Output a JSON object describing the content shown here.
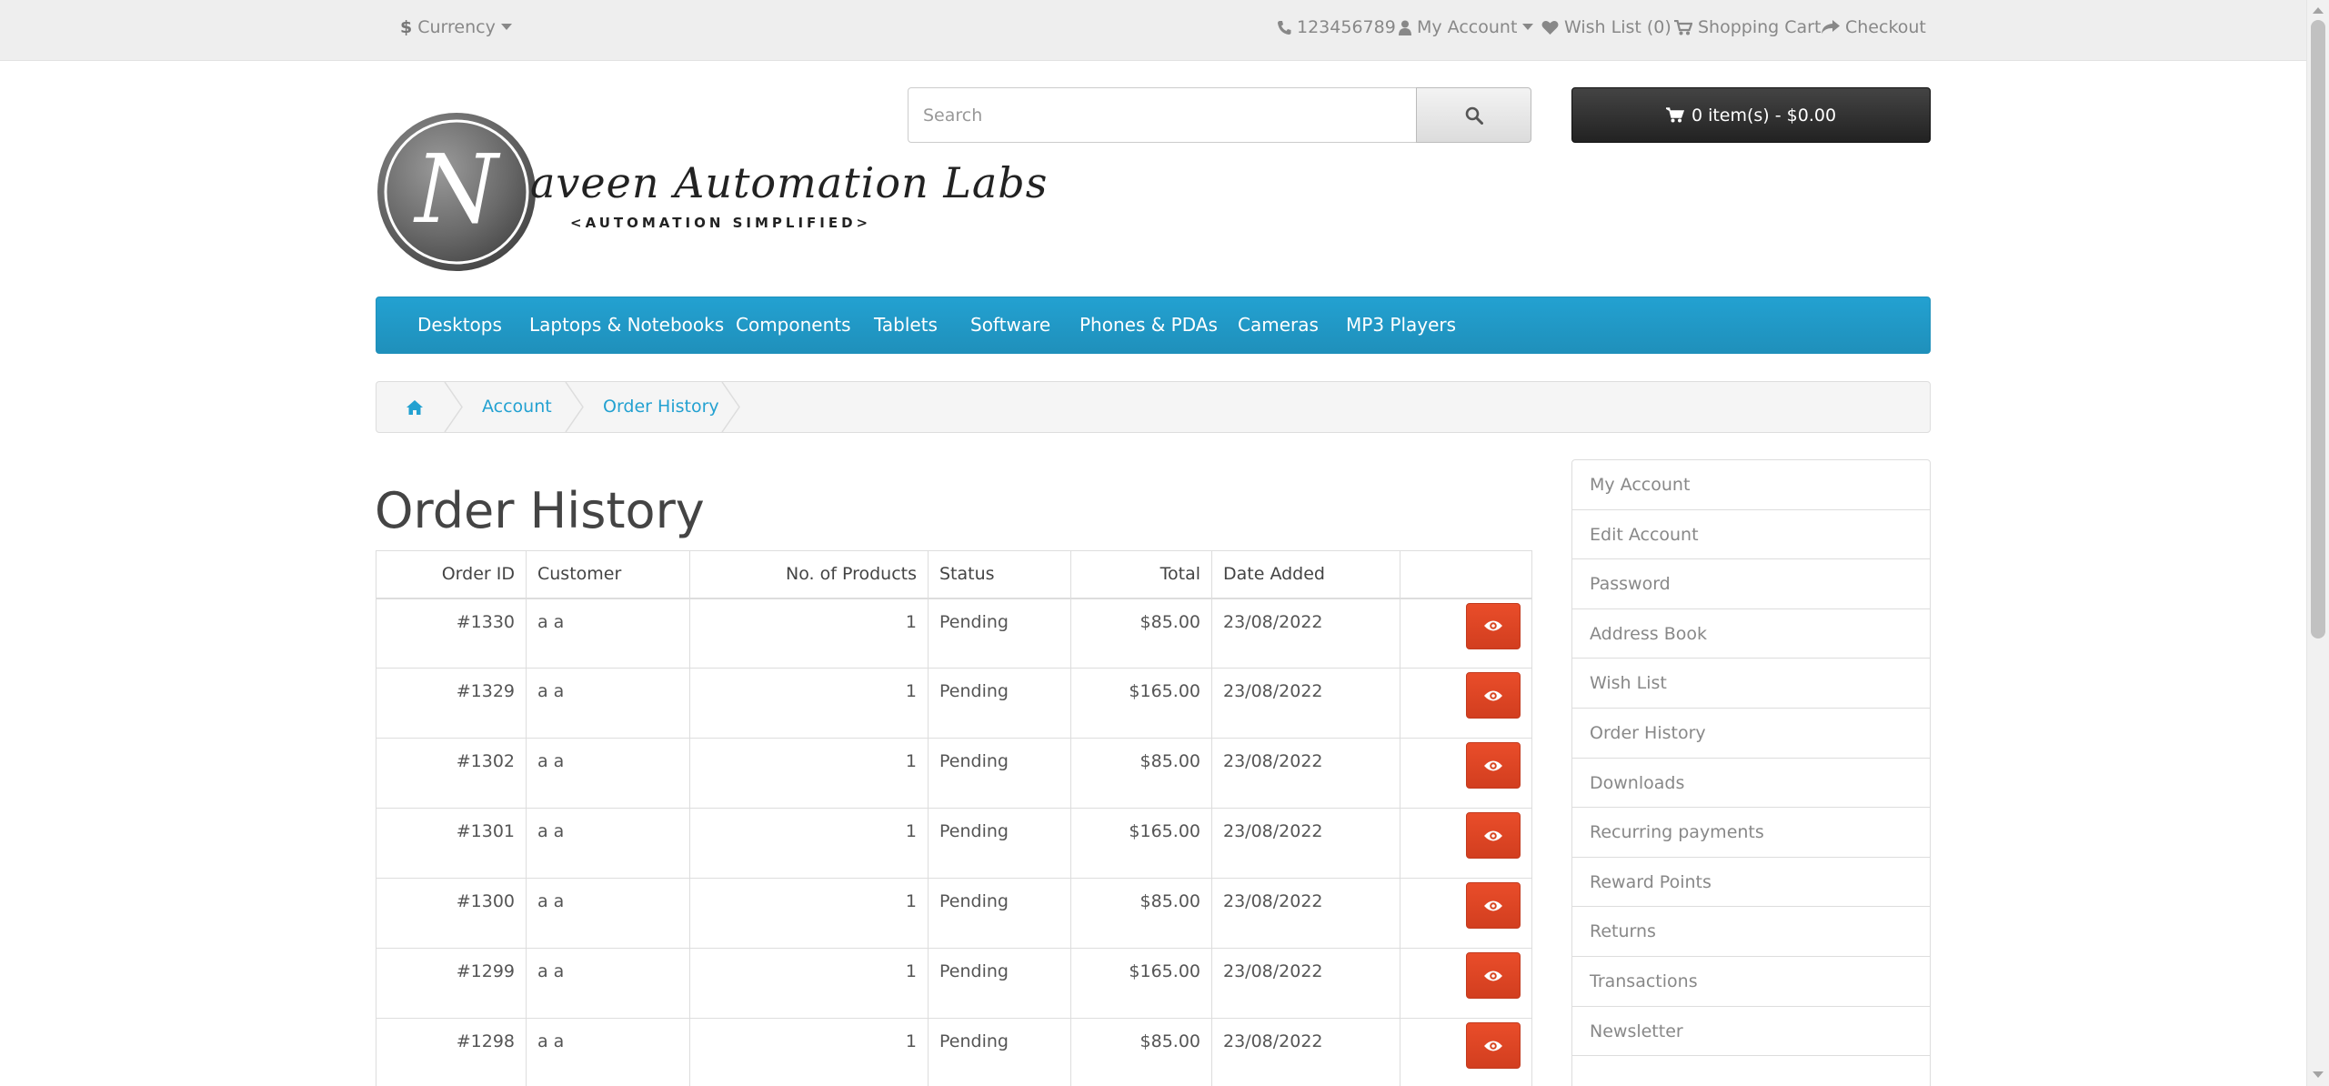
{
  "top_bar": {
    "currency_symbol": "$",
    "currency_label": "Currency",
    "phone": "123456789",
    "my_account": "My Account",
    "wish_list": "Wish List (0)",
    "shopping_cart": "Shopping Cart",
    "checkout": "Checkout"
  },
  "logo": {
    "script": "aveen Automation Labs",
    "letter": "N",
    "tagline": "<AUTOMATION SIMPLIFIED>"
  },
  "search": {
    "placeholder": "Search"
  },
  "cart": {
    "label": "0 item(s) - $0.00"
  },
  "menu": {
    "items": [
      "Desktops",
      "Laptops & Notebooks",
      "Components",
      "Tablets",
      "Software",
      "Phones & PDAs",
      "Cameras",
      "MP3 Players"
    ]
  },
  "breadcrumb": {
    "account": "Account",
    "order_history": "Order History"
  },
  "page_title": "Order History",
  "table": {
    "headers": [
      "Order ID",
      "Customer",
      "No. of Products",
      "Status",
      "Total",
      "Date Added"
    ],
    "rows": [
      {
        "id": "#1330",
        "customer": "a a",
        "products": "1",
        "status": "Pending",
        "total": "$85.00",
        "date": "23/08/2022"
      },
      {
        "id": "#1329",
        "customer": "a a",
        "products": "1",
        "status": "Pending",
        "total": "$165.00",
        "date": "23/08/2022"
      },
      {
        "id": "#1302",
        "customer": "a a",
        "products": "1",
        "status": "Pending",
        "total": "$85.00",
        "date": "23/08/2022"
      },
      {
        "id": "#1301",
        "customer": "a a",
        "products": "1",
        "status": "Pending",
        "total": "$165.00",
        "date": "23/08/2022"
      },
      {
        "id": "#1300",
        "customer": "a a",
        "products": "1",
        "status": "Pending",
        "total": "$85.00",
        "date": "23/08/2022"
      },
      {
        "id": "#1299",
        "customer": "a a",
        "products": "1",
        "status": "Pending",
        "total": "$165.00",
        "date": "23/08/2022"
      },
      {
        "id": "#1298",
        "customer": "a a",
        "products": "1",
        "status": "Pending",
        "total": "$85.00",
        "date": "23/08/2022"
      }
    ]
  },
  "account_menu": {
    "items": [
      "My Account",
      "Edit Account",
      "Password",
      "Address Book",
      "Wish List",
      "Order History",
      "Downloads",
      "Recurring payments",
      "Reward Points",
      "Returns",
      "Transactions",
      "Newsletter",
      ""
    ]
  },
  "icons": {
    "phone": "phone-icon",
    "user": "user-icon",
    "heart": "heart-icon",
    "cart": "shopping-cart-icon",
    "share": "share-icon",
    "search": "search-icon",
    "home": "home-icon",
    "view": "eye-icon"
  },
  "colors": {
    "menu_blue": "#229ac8",
    "view_button": "#e24b2a",
    "cart_button": "#363636",
    "link": "#23a1d1"
  }
}
